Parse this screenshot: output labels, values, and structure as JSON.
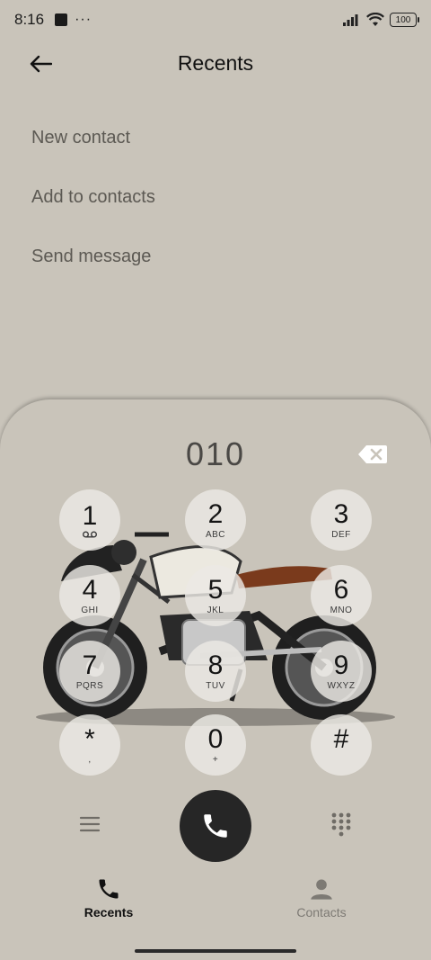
{
  "status_bar": {
    "time": "8:16",
    "dots": "···",
    "battery": "100"
  },
  "header": {
    "title": "Recents"
  },
  "menu": {
    "items": [
      "New contact",
      "Add to contacts",
      "Send message"
    ]
  },
  "dialer": {
    "number": "010",
    "keys": [
      {
        "digit": "1",
        "letters": ""
      },
      {
        "digit": "2",
        "letters": "ABC"
      },
      {
        "digit": "3",
        "letters": "DEF"
      },
      {
        "digit": "4",
        "letters": "GHI"
      },
      {
        "digit": "5",
        "letters": "JKL"
      },
      {
        "digit": "6",
        "letters": "MNO"
      },
      {
        "digit": "7",
        "letters": "PQRS"
      },
      {
        "digit": "8",
        "letters": "TUV"
      },
      {
        "digit": "9",
        "letters": "WXYZ"
      },
      {
        "digit": "*",
        "letters": ","
      },
      {
        "digit": "0",
        "letters": "+"
      },
      {
        "digit": "#",
        "letters": ""
      }
    ]
  },
  "bottom_nav": {
    "recents_label": "Recents",
    "contacts_label": "Contacts"
  },
  "colors": {
    "background": "#c9c4ba",
    "call_button": "#262626",
    "key_fill": "#ece9e4"
  },
  "icons": [
    "back-arrow-icon",
    "backspace-icon",
    "voicemail-icon",
    "menu-lines-icon",
    "phone-icon",
    "keypad-icon",
    "person-icon"
  ]
}
